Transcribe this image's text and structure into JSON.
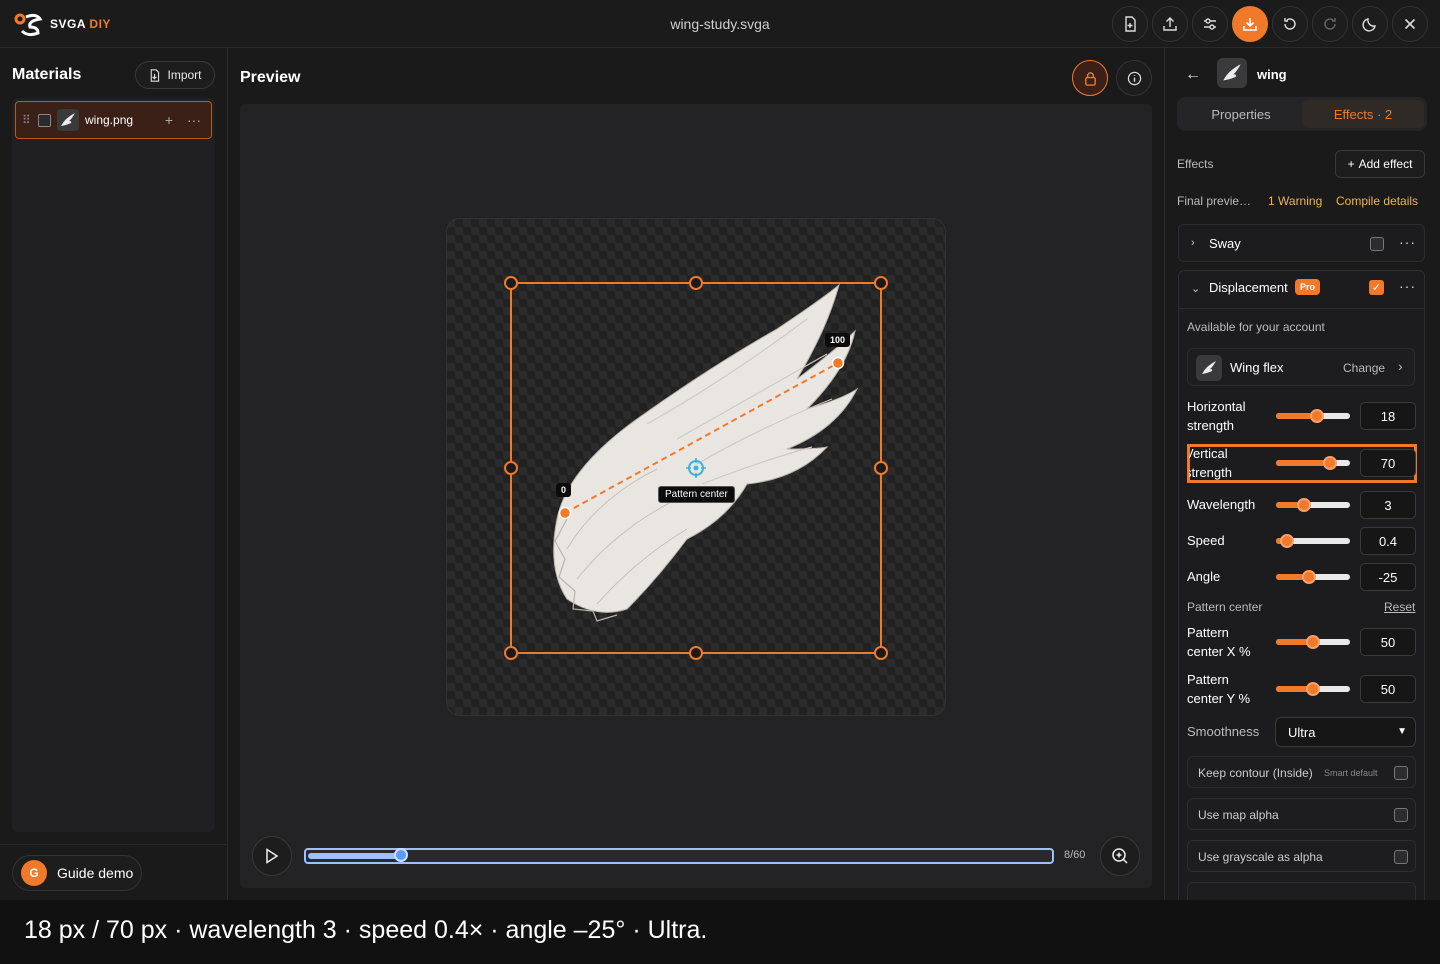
{
  "app": {
    "logo_text": "SVGA",
    "logo_suffix": "DIY",
    "document_title": "wing-study.svga"
  },
  "toolbar": {
    "buttons": [
      {
        "icon": "new-file-icon"
      },
      {
        "icon": "upload-icon"
      },
      {
        "icon": "sliders-icon"
      },
      {
        "icon": "download-icon",
        "accent": "#f07a2a"
      },
      {
        "icon": "undo-icon"
      },
      {
        "icon": "redo-icon"
      },
      {
        "icon": "theme-moon-icon"
      },
      {
        "icon": "close-icon"
      }
    ]
  },
  "materials": {
    "title": "Materials",
    "import_label": "Import",
    "items": [
      {
        "name": "wing.png",
        "selected": true
      }
    ]
  },
  "guide": {
    "avatar_letter": "G",
    "label": "Guide demo"
  },
  "preview": {
    "title": "Preview",
    "tags": {
      "start": "0",
      "end": "100",
      "center": "Pattern center"
    },
    "timeline": {
      "frame_label": "8/60",
      "progress": 0.125
    }
  },
  "inspector": {
    "layer_name": "wing",
    "tabs": {
      "properties": "Properties",
      "effects": "Effects · 2"
    },
    "effects_label": "Effects",
    "add_effect": "Add effect",
    "final_preview": "Final previe…",
    "warning": "1 Warning",
    "compile_details": "Compile details",
    "sway": {
      "title": "Sway",
      "enabled": false
    },
    "displacement": {
      "title": "Displacement",
      "badge": "Pro",
      "enabled": true,
      "availability": "Available for your account",
      "preset_name": "Wing flex",
      "preset_action": "Change",
      "controls": {
        "horizontal": {
          "label_1": "Horizontal",
          "label_2": "strength",
          "value": "18",
          "level": 0.56
        },
        "vertical": {
          "label_1": "Vertical",
          "label_2": "strength",
          "value": "70",
          "level": 0.73
        },
        "wavelength": {
          "label": "Wavelength",
          "value": "3",
          "level": 0.38
        },
        "speed": {
          "label": "Speed",
          "value": "0.4",
          "level": 0.15
        },
        "angle": {
          "label": "Angle",
          "value": "-25",
          "level": 0.45
        }
      },
      "pattern_center_label": "Pattern center",
      "reset": "Reset",
      "center_x": {
        "label_1": "Pattern",
        "label_2": "center X %",
        "value": "50",
        "level": 0.5
      },
      "center_y": {
        "label_1": "Pattern",
        "label_2": "center Y %",
        "value": "50",
        "level": 0.5
      },
      "smoothness_label": "Smoothness",
      "smoothness_value": "Ultra",
      "options": {
        "keep_contour": {
          "label": "Keep contour (Inside)",
          "hint": "Smart default",
          "checked": false
        },
        "map_alpha": {
          "label": "Use map alpha",
          "checked": false
        },
        "grayscale_alpha": {
          "label": "Use grayscale as alpha",
          "checked": false
        }
      }
    }
  },
  "caption": "18 px / 70 px · wavelength 3 · speed 0.4× · angle –25° · Ultra.",
  "colors": {
    "accent": "#f07a2a",
    "timeline": "#9ec0ff",
    "warning": "#f2b24a"
  }
}
